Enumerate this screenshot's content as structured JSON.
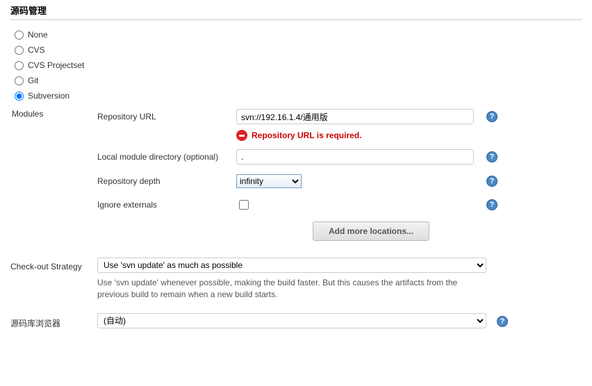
{
  "section_title": "源码管理",
  "scm": {
    "options": [
      "None",
      "CVS",
      "CVS Projectset",
      "Git",
      "Subversion"
    ],
    "selected": "Subversion"
  },
  "modules_label": "Modules",
  "fields": {
    "repo_url_label": "Repository URL",
    "repo_url_value": "svn://192.16.1.4/通用版",
    "repo_url_error": "Repository URL is required.",
    "local_dir_label": "Local module directory (optional)",
    "local_dir_value": ".",
    "depth_label": "Repository depth",
    "depth_value": "infinity",
    "ignore_externals_label": "Ignore externals",
    "ignore_externals_checked": false,
    "add_more_label": "Add more locations..."
  },
  "checkout": {
    "label": "Check-out Strategy",
    "selected": "Use 'svn update' as much as possible",
    "hint": "Use 'svn update' whenever possible, making the build faster. But this causes the artifacts from the previous build to remain when a new build starts."
  },
  "browser": {
    "label": "源码库浏览器",
    "selected": "(自动)"
  }
}
